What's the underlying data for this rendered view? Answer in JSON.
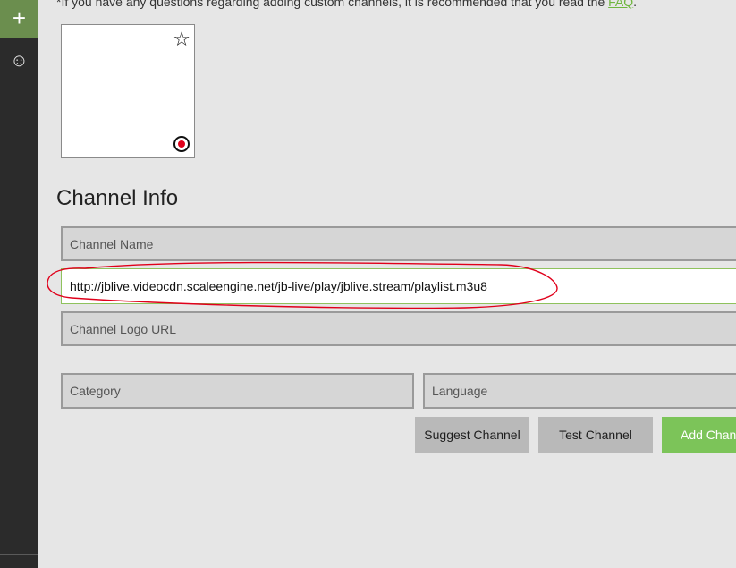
{
  "rail": {
    "add_icon": "plus-icon",
    "smile_icon": "smiley-icon",
    "add_glyph": "+",
    "smile_glyph": "☺"
  },
  "notice": {
    "text": "*If you have any questions regarding adding custom channels, it is recommended that you read the ",
    "link": "FAQ",
    "suffix": "."
  },
  "logo_preview": {
    "star_glyph": "☆",
    "star_icon": "star-icon",
    "record_icon": "record-icon"
  },
  "section_title": "Channel Info",
  "fields": {
    "channel_name": {
      "placeholder": "Channel Name",
      "value": ""
    },
    "stream_url": {
      "value": "http://jblive.videocdn.scaleengine.net/jb-live/play/jblive.stream/playlist.m3u8"
    },
    "channel_logo_url": {
      "placeholder": "Channel Logo URL",
      "value": ""
    },
    "category": {
      "placeholder": "Category",
      "value": ""
    },
    "language": {
      "placeholder": "Language",
      "value": ""
    }
  },
  "buttons": {
    "suggest": "Suggest Channel",
    "test": "Test Channel",
    "add": "Add Chan"
  },
  "colors": {
    "accent": "#7cc459",
    "rail": "#2b2b2b",
    "annotation": "#e0001b"
  }
}
